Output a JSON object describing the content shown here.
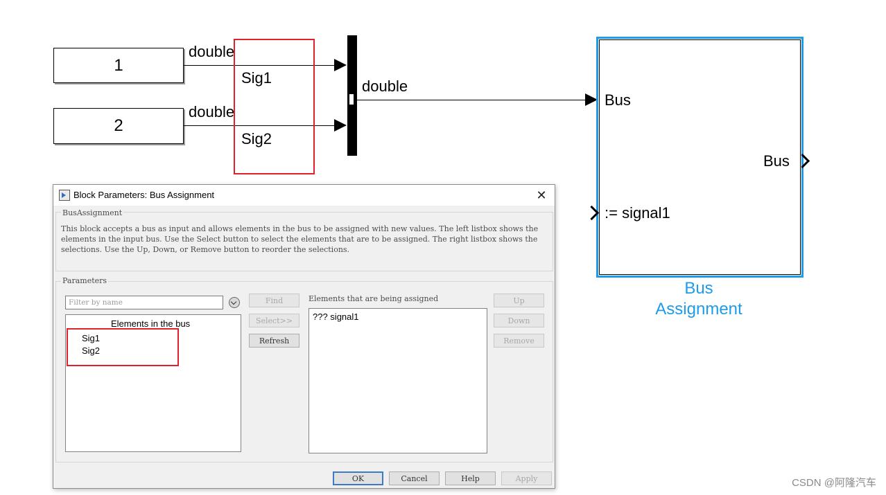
{
  "diagram": {
    "constant1_value": "1",
    "constant2_value": "2",
    "constant1_type": "double",
    "constant2_type": "double",
    "sig1_label": "Sig1",
    "sig2_label": "Sig2",
    "bus_out_type": "double",
    "bus_assign_in_bus": "Bus",
    "bus_assign_out_bus": "Bus",
    "bus_assign_in_signal": ":= signal1",
    "bus_assign_name_line1": "Bus",
    "bus_assign_name_line2": "Assignment",
    "selected_color": "#1e9be9",
    "highlight_color": "#e0202a"
  },
  "dialog": {
    "title": "Block Parameters: Bus Assignment",
    "close_glyph": "✕",
    "section_label": "BusAssignment",
    "description": "This block accepts a bus as input and allows elements in the bus to be assigned with new values. The left listbox shows the elements in the input bus. Use the Select button to select the elements that are to be assigned. The right listbox shows the selections. Use the Up, Down, or Remove button to reorder the selections.",
    "parameters_label": "Parameters",
    "filter_placeholder": "Filter by name",
    "left_list_title": "Elements in the bus",
    "left_list_items": [
      "Sig1",
      "Sig2"
    ],
    "right_list_title": "Elements that are being assigned",
    "right_list_items": [
      "??? signal1"
    ],
    "find_label": "Find",
    "select_label": "Select>>",
    "refresh_label": "Refresh",
    "up_label": "Up",
    "down_label": "Down",
    "remove_label": "Remove",
    "ok_label": "OK",
    "cancel_label": "Cancel",
    "help_label": "Help",
    "apply_label": "Apply"
  },
  "watermark": "CSDN @阿隆汽车"
}
